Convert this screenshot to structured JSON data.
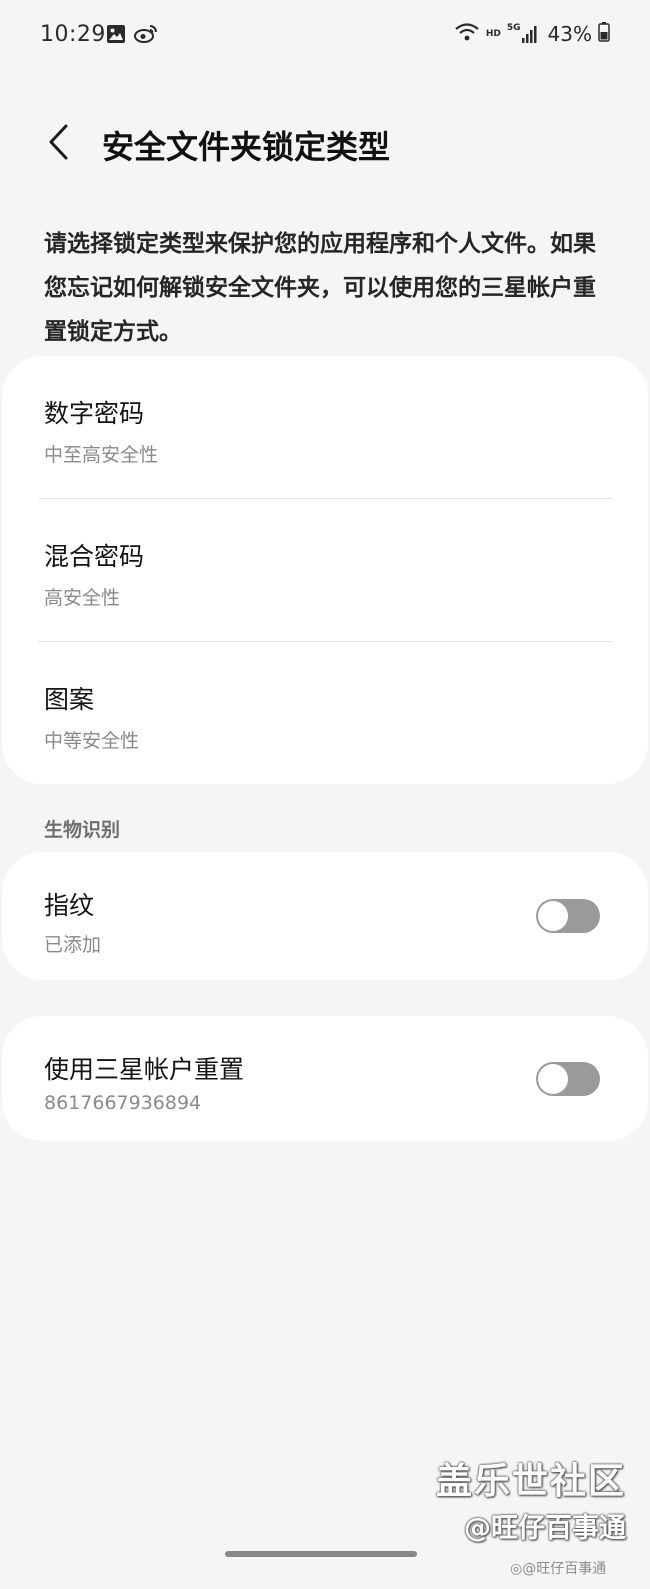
{
  "status_bar": {
    "time": "10:29",
    "left_icons": [
      "gallery-icon",
      "weibo-icon"
    ],
    "right_icons": [
      "wifi-icon",
      "hd-icon",
      "5g-signal-icon",
      "battery-icon"
    ],
    "hd_label": "HD",
    "network_label": "5G",
    "battery": "43%"
  },
  "header": {
    "title": "安全文件夹锁定类型"
  },
  "description": "请选择锁定类型来保护您的应用程序和个人文件。如果您忘记如何解锁安全文件夹，可以使用您的三星帐户重置锁定方式。",
  "lock_types": [
    {
      "title": "数字密码",
      "subtitle": "中至高安全性"
    },
    {
      "title": "混合密码",
      "subtitle": "高安全性"
    },
    {
      "title": "图案",
      "subtitle": "中等安全性"
    }
  ],
  "biometrics": {
    "section_label": "生物识别",
    "fingerprint": {
      "title": "指纹",
      "subtitle": "已添加",
      "enabled": false
    }
  },
  "samsung_reset": {
    "title": "使用三星帐户重置",
    "subtitle": "8617667936894",
    "enabled": false
  },
  "watermark": {
    "line1": "盖乐世社区",
    "line2": "@旺仔百事通",
    "line3": "@旺仔百事通"
  },
  "colors": {
    "background": "#f5f5f5",
    "card": "#ffffff",
    "toggle_off": "#9a9a9a"
  }
}
